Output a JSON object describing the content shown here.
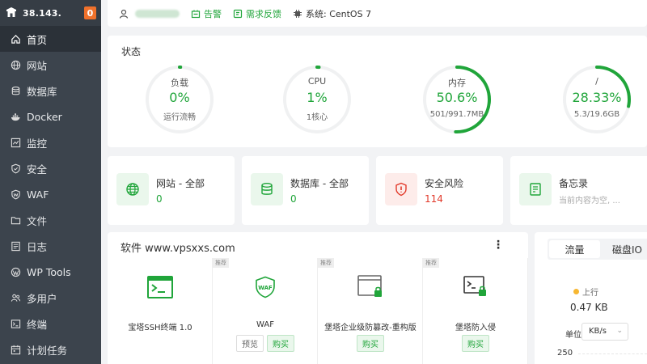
{
  "sidebar": {
    "ip": "38.143.",
    "badge": "0",
    "items": [
      {
        "label": "首页",
        "icon": "home-icon",
        "active": true
      },
      {
        "label": "网站",
        "icon": "globe-icon"
      },
      {
        "label": "数据库",
        "icon": "database-icon"
      },
      {
        "label": "Docker",
        "icon": "docker-icon"
      },
      {
        "label": "监控",
        "icon": "monitor-icon"
      },
      {
        "label": "安全",
        "icon": "shield-icon"
      },
      {
        "label": "WAF",
        "icon": "waf-shield-icon"
      },
      {
        "label": "文件",
        "icon": "folder-icon"
      },
      {
        "label": "日志",
        "icon": "log-icon"
      },
      {
        "label": "WP Tools",
        "icon": "wordpress-icon"
      },
      {
        "label": "多用户",
        "icon": "users-icon"
      },
      {
        "label": "终端",
        "icon": "terminal-icon"
      },
      {
        "label": "计划任务",
        "icon": "calendar-icon"
      }
    ]
  },
  "topbar": {
    "alert": "告警",
    "feedback": "需求反馈",
    "system": "系统: CentOS 7"
  },
  "status": {
    "title": "状态",
    "gauges": [
      {
        "label": "负载",
        "value": "0%",
        "sub": "运行流畅",
        "percent": 0
      },
      {
        "label": "CPU",
        "value": "1%",
        "sub": "1核心",
        "percent": 1
      },
      {
        "label": "内存",
        "value": "50.6%",
        "sub": "501/991.7MB",
        "percent": 50.6
      },
      {
        "label": "/",
        "value": "28.33%",
        "sub": "5.3/19.6GB",
        "percent": 28.33
      }
    ]
  },
  "cards": [
    {
      "name": "网站 - 全部",
      "count": "0"
    },
    {
      "name": "数据库 - 全部",
      "count": "0"
    },
    {
      "name": "安全风险",
      "count": "114"
    },
    {
      "name": "备忘录",
      "count": "当前内容为空, ..."
    }
  ],
  "software": {
    "title": "软件  www.vpsxxs.com",
    "more": "⋮",
    "plugins": [
      {
        "name": "宝塔SSH终端 1.0",
        "tag": "",
        "preview": "",
        "buy": ""
      },
      {
        "name": "WAF",
        "tag": "推荐",
        "preview": "预览",
        "buy": "购买"
      },
      {
        "name": "堡塔企业级防篡改-重构版",
        "tag": "推荐",
        "preview": "",
        "buy": "购买"
      },
      {
        "name": "堡塔防入侵",
        "tag": "推荐",
        "preview": "",
        "buy": "购买"
      }
    ]
  },
  "traffic": {
    "tab_traffic": "流量",
    "tab_disk": "磁盘IO",
    "up_label": "上行",
    "up_speed": "0.47 KB",
    "unit_label": "单位",
    "unit_value": "KB/s",
    "y_tick": "250"
  },
  "colors": {
    "accent": "#20a53a",
    "danger": "#e23a2b",
    "sidebar": "#3c444d"
  }
}
